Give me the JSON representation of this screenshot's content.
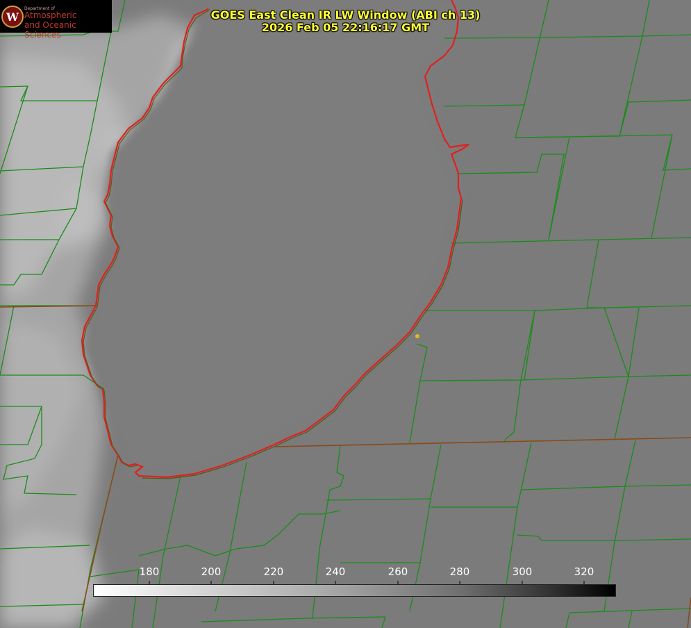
{
  "title_line1": "GOES East Clean IR LW Window (ABI ch 13)",
  "title_line2": "2026 Feb 05 22:16:17 GMT",
  "logo": {
    "dept": "Department of",
    "name_line1": "Atmospheric",
    "name_line2": "and Oceanic Sciences"
  },
  "colorbar": {
    "ticks": [
      "180",
      "200",
      "220",
      "240",
      "260",
      "280",
      "300",
      "320"
    ],
    "min_color": "#ffffff",
    "max_color": "#000000"
  },
  "colors": {
    "county_lines": "#1a8c1a",
    "coastline": "#e02020",
    "title": "#ffff33",
    "marker": "#d4c020"
  }
}
